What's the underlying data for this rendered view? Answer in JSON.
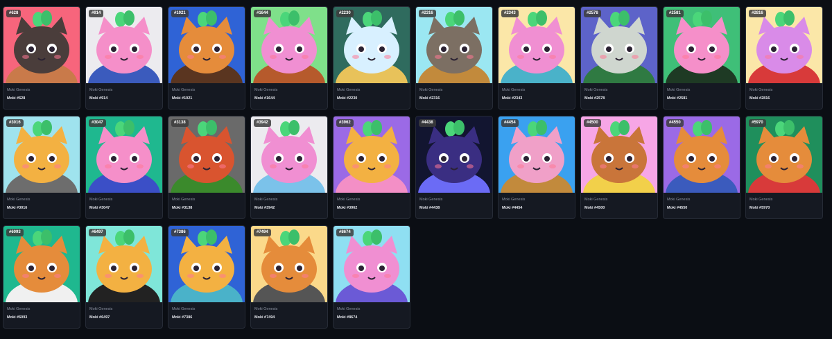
{
  "grid": {
    "cards": [
      {
        "id": "#628",
        "collection": "Moki Genesis",
        "name": "Moki #628",
        "bg": "#f7657c",
        "body": "#4a3d3b",
        "accent": "#c97a4a"
      },
      {
        "id": "#914",
        "collection": "Moki Genesis",
        "name": "Moki #914",
        "bg": "#ecebef",
        "body": "#f58fc9",
        "accent": "#3b5bbd"
      },
      {
        "id": "#1021",
        "collection": "Moki Genesis",
        "name": "Moki #1021",
        "bg": "#2f63d6",
        "body": "#e58c3b",
        "accent": "#5a3520"
      },
      {
        "id": "#1644",
        "collection": "Moki Genesis",
        "name": "Moki #1644",
        "bg": "#7fe08a",
        "body": "#f08fd2",
        "accent": "#b65a2c"
      },
      {
        "id": "#2230",
        "collection": "Moki Genesis",
        "name": "Moki #2230",
        "bg": "#2f6b5e",
        "body": "#d8f0ff",
        "accent": "#e8c25a"
      },
      {
        "id": "#2316",
        "collection": "Moki Genesis",
        "name": "Moki #2316",
        "bg": "#9be7f2",
        "body": "#7c6f63",
        "accent": "#c28a3c"
      },
      {
        "id": "#2343",
        "collection": "Moki Genesis",
        "name": "Moki #2343",
        "bg": "#fbe7a8",
        "body": "#f08fd2",
        "accent": "#4ab2c9"
      },
      {
        "id": "#2578",
        "collection": "Moki Genesis",
        "name": "Moki #2578",
        "bg": "#5d63c9",
        "body": "#cfd6cf",
        "accent": "#2f7a42"
      },
      {
        "id": "#2581",
        "collection": "Moki Genesis",
        "name": "Moki #2581",
        "bg": "#3fbf78",
        "body": "#f58fc9",
        "accent": "#1e3a24"
      },
      {
        "id": "#2816",
        "collection": "Moki Genesis",
        "name": "Moki #2816",
        "bg": "#fbe7a8",
        "body": "#d98be8",
        "accent": "#d83a3a"
      },
      {
        "id": "#3016",
        "collection": "Moki Genesis",
        "name": "Moki #3016",
        "bg": "#9fe3ee",
        "body": "#f3b142",
        "accent": "#6d6d6d"
      },
      {
        "id": "#3047",
        "collection": "Moki Genesis",
        "name": "Moki #3047",
        "bg": "#1fb88f",
        "body": "#f58fc9",
        "accent": "#3b4fc7"
      },
      {
        "id": "#3138",
        "collection": "Moki Genesis",
        "name": "Moki #3138",
        "bg": "#6a6a6a",
        "body": "#d9542f",
        "accent": "#3b8a2c"
      },
      {
        "id": "#3942",
        "collection": "Moki Genesis",
        "name": "Moki #3942",
        "bg": "#ecebef",
        "body": "#f08fd2",
        "accent": "#7bc2ea"
      },
      {
        "id": "#3962",
        "collection": "Moki Genesis",
        "name": "Moki #3962",
        "bg": "#9b6ae6",
        "body": "#f3b142",
        "accent": "#f38fc6"
      },
      {
        "id": "#4438",
        "collection": "Moki Genesis",
        "name": "Moki #4438",
        "bg": "#121530",
        "body": "#3a2e82",
        "accent": "#6b6bf5"
      },
      {
        "id": "#4454",
        "collection": "Moki Genesis",
        "name": "Moki #4454",
        "bg": "#3aa1f0",
        "body": "#f0a0c8",
        "accent": "#c28a3c"
      },
      {
        "id": "#4500",
        "collection": "Moki Genesis",
        "name": "Moki #4500",
        "bg": "#f7a6e6",
        "body": "#c9753a",
        "accent": "#f2d04a"
      },
      {
        "id": "#4550",
        "collection": "Moki Genesis",
        "name": "Moki #4550",
        "bg": "#9b6ae6",
        "body": "#e58c3b",
        "accent": "#3b5bbd"
      },
      {
        "id": "#5970",
        "collection": "Moki Genesis",
        "name": "Moki #5970",
        "bg": "#1f8f5c",
        "body": "#e58c3b",
        "accent": "#d83a3a"
      },
      {
        "id": "#6093",
        "collection": "Moki Genesis",
        "name": "Moki #6093",
        "bg": "#1fb88f",
        "body": "#e58c3b",
        "accent": "#f0f0f0"
      },
      {
        "id": "#6497",
        "collection": "Moki Genesis",
        "name": "Moki #6497",
        "bg": "#7fe6d9",
        "body": "#f3b142",
        "accent": "#222222"
      },
      {
        "id": "#7386",
        "collection": "Moki Genesis",
        "name": "Moki #7386",
        "bg": "#2f63d6",
        "body": "#f3b142",
        "accent": "#4ab2c9"
      },
      {
        "id": "#7494",
        "collection": "Moki Genesis",
        "name": "Moki #7494",
        "bg": "#fbd98a",
        "body": "#e58c3b",
        "accent": "#555555"
      },
      {
        "id": "#8674",
        "collection": "Moki Genesis",
        "name": "Moki #8674",
        "bg": "#8fdff2",
        "body": "#f08fd2",
        "accent": "#6b5ad6"
      }
    ]
  }
}
